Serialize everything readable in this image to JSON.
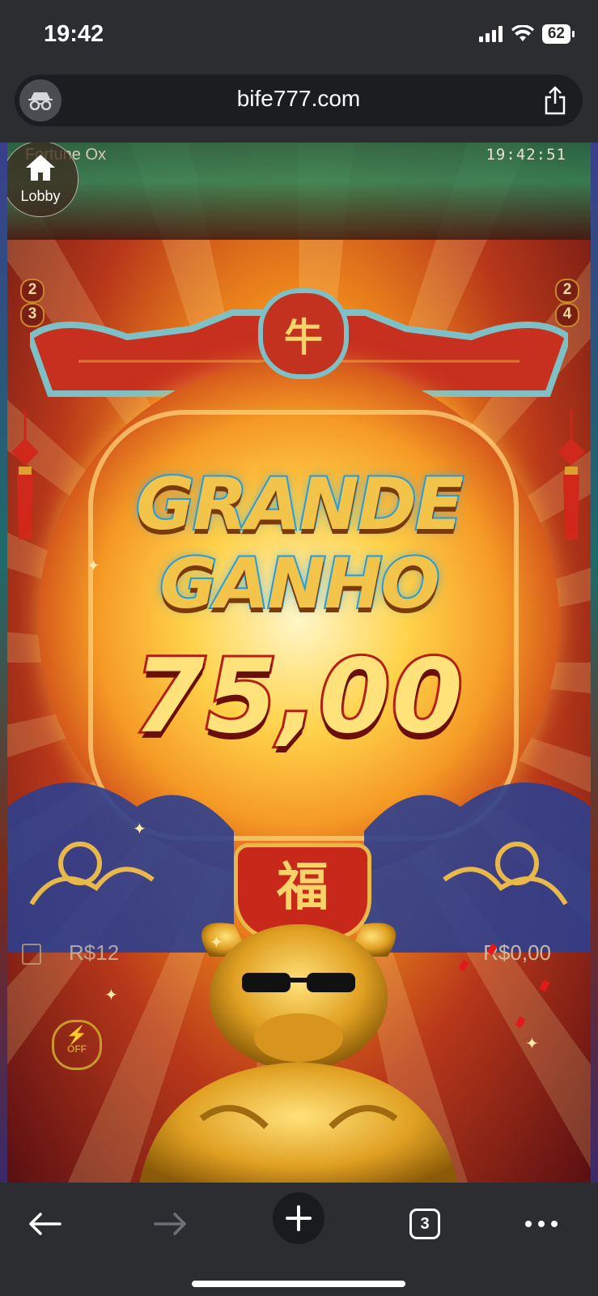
{
  "status_bar": {
    "time": "19:42",
    "battery": "62"
  },
  "browser": {
    "url": "bife777.com"
  },
  "game": {
    "title": "Fortune Ox",
    "clock": "19:42:51",
    "lobby_label": "Lobby",
    "win_title_line1": "GRANDE",
    "win_title_line2": "GANHO",
    "win_amount": "75,00",
    "balance_left": "R$12",
    "balance_right": "R$0,00",
    "turbo_label": "OFF",
    "seal_char": "牛",
    "plaque_char": "福",
    "paylines_left": [
      "2",
      "3"
    ],
    "paylines_right": [
      "2",
      "4"
    ]
  },
  "nav": {
    "tab_count": "3"
  },
  "colors": {
    "accent_gold": "#f2c44a",
    "title_outline": "#2a9ad6",
    "amount_outline": "#b51f14"
  }
}
